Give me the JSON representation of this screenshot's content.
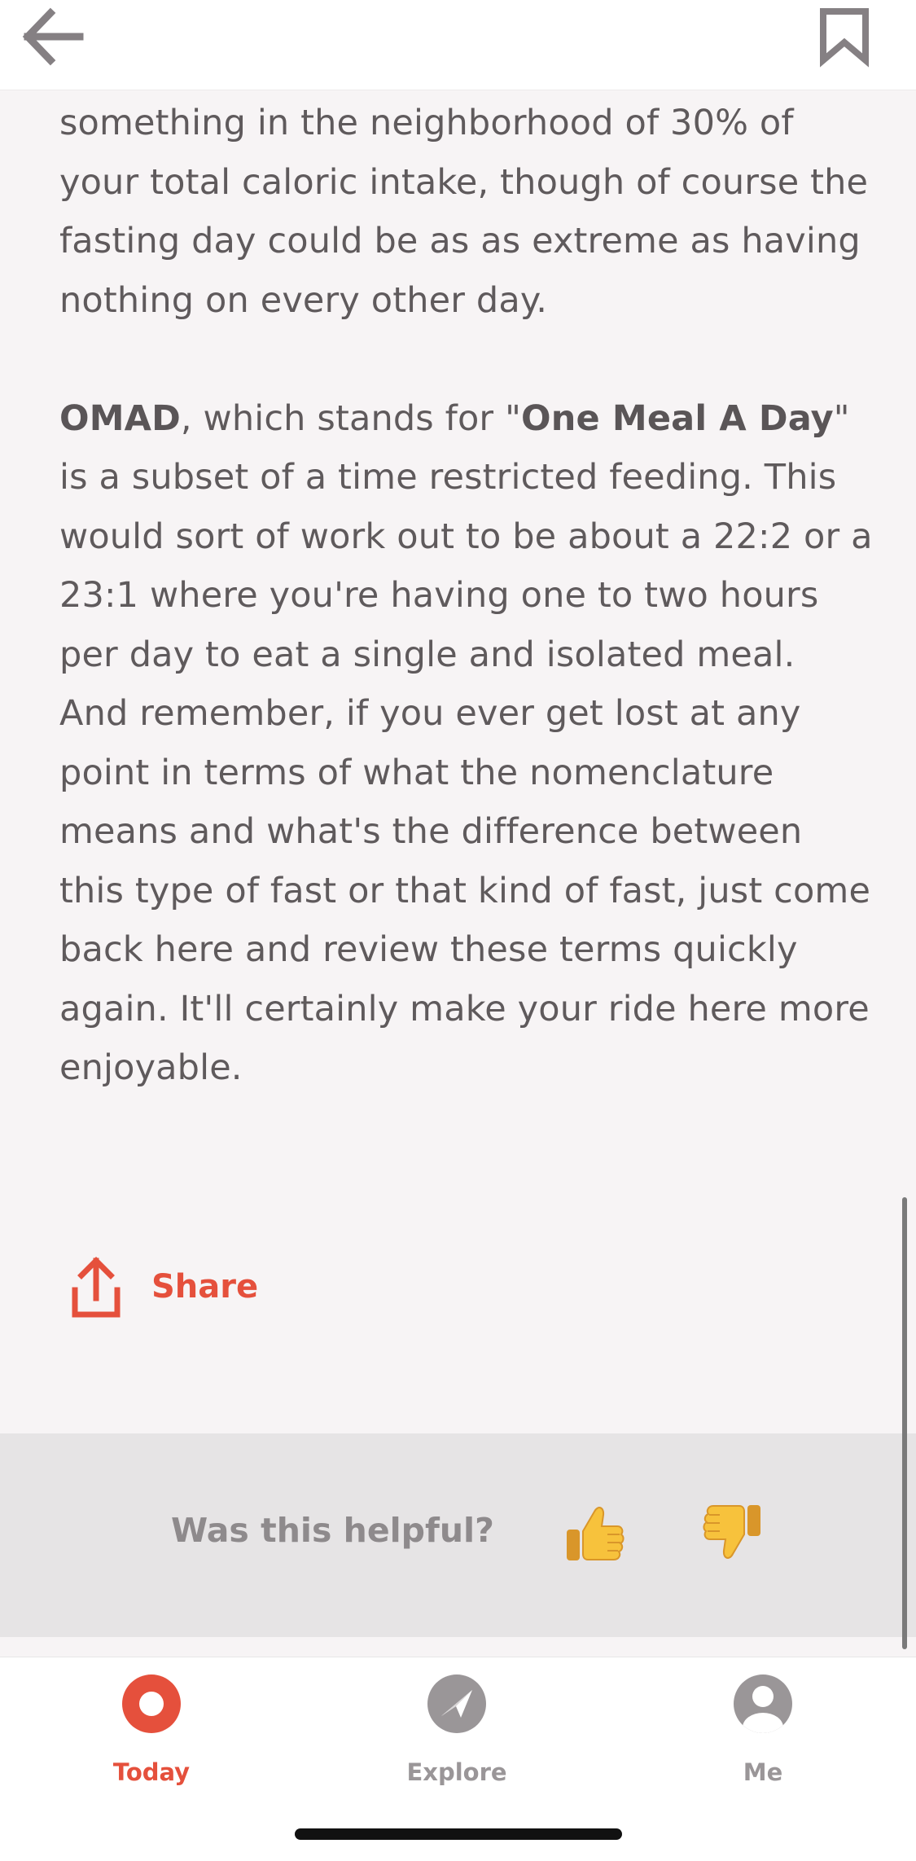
{
  "header": {
    "back_icon": "arrow-left-icon",
    "bookmark_icon": "bookmark-icon",
    "icon_color": "#858083"
  },
  "article": {
    "paragraph1": "something in the neighborhood of 30% of your total caloric intake, though of course the fasting day could be as as extreme as having nothing on every other day.",
    "p2_term": "OMAD",
    "p2_text1": ", which stands for \"",
    "p2_expansion": "One Meal A Day",
    "p2_text2": "\" is a subset of a time restricted feeding. This would sort of work out to be about a 22:2 or a 23:1 where you're having one to two hours per day to eat a single and isolated meal. And remember, if you ever get lost at any point in terms of what the nomenclature means and what's the difference between this type of fast or that kind of fast, just come back here and review these terms quickly again. It'll certainly make your ride here more enjoyable."
  },
  "share": {
    "label": "Share",
    "icon": "share-upload-icon",
    "color": "#e5503c"
  },
  "feedback": {
    "question": "Was this helpful?",
    "thumbs_up_icon": "thumbs-up-icon",
    "thumbs_down_icon": "thumbs-down-icon"
  },
  "tabs": [
    {
      "label": "Today",
      "icon": "today-ring-icon",
      "active": true,
      "color": "#e5503c"
    },
    {
      "label": "Explore",
      "icon": "compass-icon",
      "active": false,
      "color": "#9a9698"
    },
    {
      "label": "Me",
      "icon": "profile-icon",
      "active": false,
      "color": "#9a9698"
    }
  ]
}
